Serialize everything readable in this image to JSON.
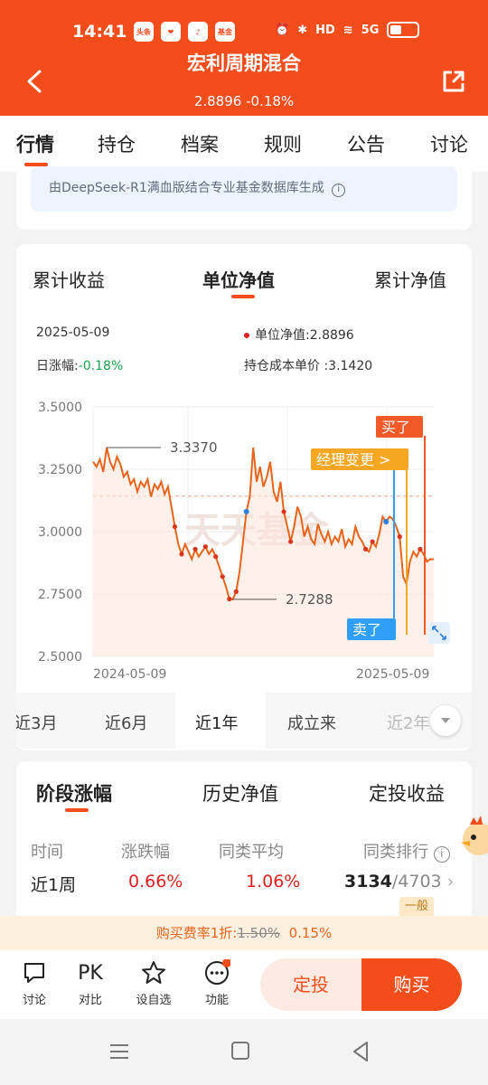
{
  "status_bar": {
    "time": "14:41",
    "app_icons": [
      "头条",
      "❤",
      "♪",
      "基金"
    ],
    "network": "5G",
    "hd": "HD"
  },
  "header": {
    "title": "宏利周期混合",
    "nav_value": "2.8896",
    "change": "-0.18%"
  },
  "tabs": [
    "行情",
    "持仓",
    "档案",
    "规则",
    "公告",
    "讨论"
  ],
  "ai_note": {
    "text": "由DeepSeek-R1满血版结合专业基金数据库生成"
  },
  "chart_tabs": [
    "累计收益",
    "单位净值",
    "累计净值"
  ],
  "info": {
    "date": "2025-05-09",
    "nav_label": "单位净值:",
    "nav_value": "2.8896",
    "daily_label": "日涨幅:",
    "daily_value": "-0.18%",
    "cost_label": "持仓成本单价 :",
    "cost_value": "3.1420"
  },
  "chart_data": {
    "type": "line",
    "watermark": "天天基金",
    "x_tick_labels": [
      "2024-05-09",
      "2025-05-09"
    ],
    "y_tick_labels": [
      "3.5000",
      "3.2500",
      "3.0000",
      "2.7500",
      "2.5000"
    ],
    "ylim": [
      2.5,
      3.5
    ],
    "y_ticks": [
      3.5,
      3.25,
      3.0,
      2.75,
      2.5
    ],
    "cost_line": 3.142,
    "max_label": "3.3370",
    "min_label": "2.7288",
    "max_value": 3.337,
    "min_value": 2.7288,
    "color_line": "#e8641b",
    "series": [
      {
        "values": [
          3.28,
          3.26,
          3.29,
          3.24,
          3.337,
          3.28,
          3.25,
          3.3,
          3.27,
          3.22,
          3.24,
          3.19,
          3.21,
          3.16,
          3.2,
          3.18,
          3.21,
          3.14,
          3.19,
          3.17,
          3.2,
          3.15,
          3.18,
          3.1,
          3.02,
          2.95,
          2.91,
          2.95,
          2.92,
          2.89,
          2.93,
          2.9,
          2.92,
          2.94,
          2.91,
          2.93,
          2.9,
          2.86,
          2.82,
          2.78,
          2.73,
          2.7288,
          2.76,
          2.84,
          2.96,
          3.08,
          3.14,
          3.337,
          3.2,
          3.26,
          3.18,
          3.22,
          3.28,
          3.16,
          3.12,
          3.2,
          3.08,
          3.02,
          2.96,
          3.02,
          3.1,
          3.06,
          2.98,
          3.02,
          2.97,
          2.95,
          3.03,
          2.99,
          2.96,
          3.0,
          2.95,
          2.98,
          2.96,
          3.01,
          2.94,
          2.97,
          2.95,
          3.02,
          2.98,
          2.96,
          2.93,
          2.92,
          2.96,
          2.94,
          2.99,
          3.06,
          3.04,
          3.06,
          3.05,
          3.02,
          2.98,
          2.82,
          2.79,
          2.88,
          2.92,
          2.9,
          2.93,
          2.91,
          2.88,
          2.89,
          2.8896
        ]
      }
    ]
  },
  "chart_tags": {
    "buy": "买了",
    "sell": "卖了",
    "manager": "经理变更 >"
  },
  "periods": [
    "近3月",
    "近6月",
    "近1年",
    "成立来",
    "近2年"
  ],
  "stage_tabs": [
    "阶段涨幅",
    "历史净值",
    "定投收益"
  ],
  "stage_table": {
    "headers": [
      "时间",
      "涨跌幅",
      "同类平均",
      "同类排行"
    ],
    "row": {
      "period": "近1周",
      "change": "0.66%",
      "avg": "1.06%",
      "rank": "3134",
      "total": "/4703",
      "level": "一般"
    }
  },
  "promo": {
    "prefix": "购买费率1折:",
    "old": "1.50%",
    "new": "0.15%"
  },
  "bottom_bar": {
    "items": [
      {
        "icon": "💬",
        "label": "讨论"
      },
      {
        "icon": "PK",
        "label": "对比"
      },
      {
        "icon": "☆",
        "label": "设自选"
      },
      {
        "icon": "⋯",
        "label": "功能"
      }
    ],
    "dingtou": "定投",
    "buy": "购买"
  }
}
